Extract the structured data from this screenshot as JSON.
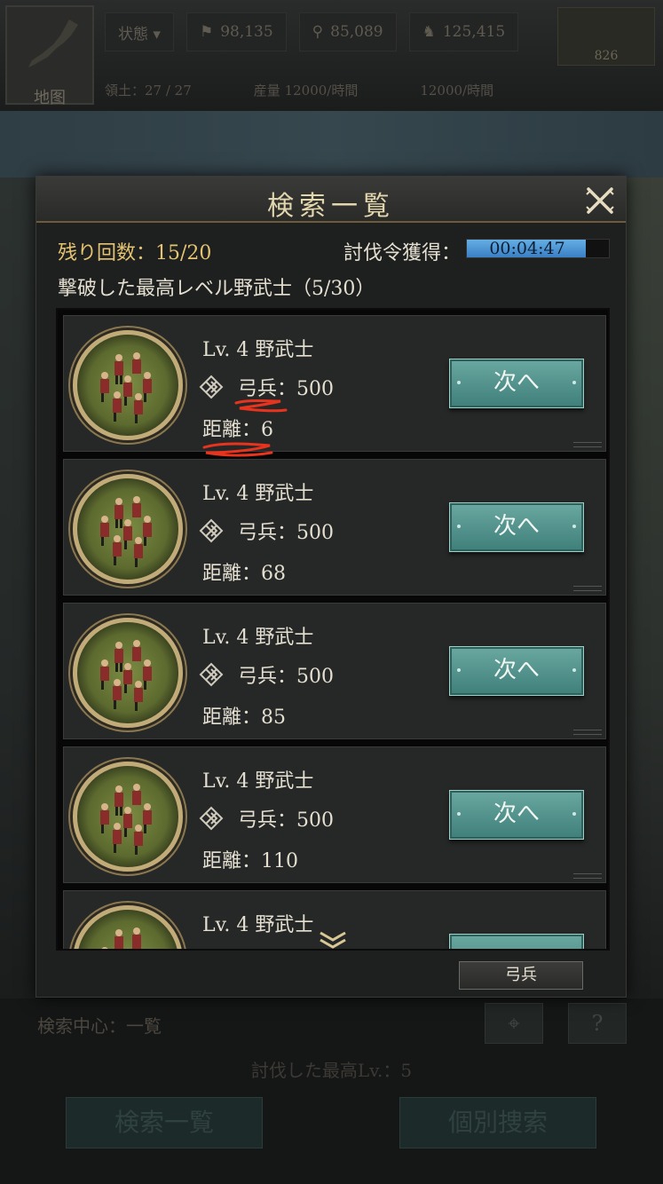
{
  "background": {
    "map_label": "地图",
    "status_chip": "状態 ▾",
    "chip2": "98,135",
    "chip3": "85,089",
    "chip4": "125,415",
    "gold_value": "826",
    "territory": "領土：27 / 27",
    "production_label": "産量",
    "production1": "12000/時間",
    "production2": "12000/時間",
    "search_center": "検索中心：一覧",
    "highest_lv": "討伐した最高Lv.：5",
    "button_list": "検索一覧",
    "button_individual": "個別捜索"
  },
  "modal": {
    "title": "検索一覧",
    "remaining": "残り回数：15/20",
    "timer_label": "討伐令獲得：",
    "timer_value": "00:04:47",
    "timer_progress": 0.84,
    "highest_level": "撃破した最高レベル野武士（5/30）",
    "filter_button": "弓兵"
  },
  "items": [
    {
      "level": "Lv. 4  野武士",
      "troop": "弓兵：500",
      "distance": "距離：6",
      "button": "次へ"
    },
    {
      "level": "Lv. 4  野武士",
      "troop": "弓兵：500",
      "distance": "距離：68",
      "button": "次へ"
    },
    {
      "level": "Lv. 4  野武士",
      "troop": "弓兵：500",
      "distance": "距離：85",
      "button": "次へ"
    },
    {
      "level": "Lv. 4  野武士",
      "troop": "弓兵：500",
      "distance": "距離：110",
      "button": "次へ"
    },
    {
      "level": "Lv. 4  野武士",
      "troop": "",
      "distance": "",
      "button": ""
    }
  ],
  "colors": {
    "accent_gold": "#e4c473",
    "button_teal": "#4f8f89",
    "timer_blue": "#4f9ad8",
    "annotation_red": "#e8331e"
  },
  "icons": {
    "close": "close-x-icon",
    "troop": "archer-troop-icon",
    "scroll": "double-chevron-down-icon"
  }
}
